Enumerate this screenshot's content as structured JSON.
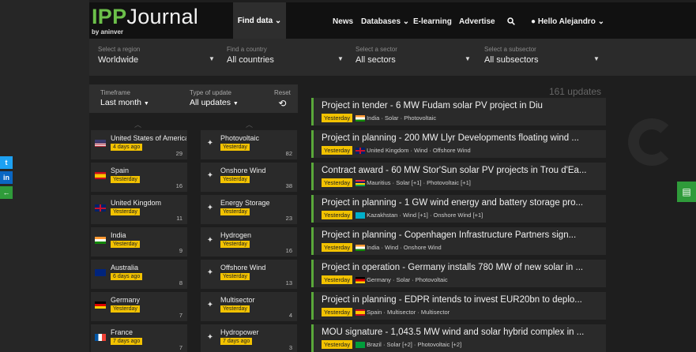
{
  "logo": {
    "brand_ipp": "IPP",
    "brand_rest": "Journal",
    "byline": "by aninver"
  },
  "nav": {
    "find_data": "Find data",
    "items": [
      "News",
      "Databases",
      "E-learning",
      "Advertise"
    ],
    "user": "Hello Alejandro"
  },
  "filters": [
    {
      "label": "Select a region",
      "value": "Worldwide"
    },
    {
      "label": "Find a country",
      "value": "All countries"
    },
    {
      "label": "Select a sector",
      "value": "All sectors"
    },
    {
      "label": "Select a subsector",
      "value": "All subsectors"
    }
  ],
  "timeframe": {
    "label": "Timeframe",
    "value": "Last month"
  },
  "update_type": {
    "label": "Type of update",
    "value": "All updates"
  },
  "reset": {
    "label": "Reset",
    "icon": "reset-icon"
  },
  "update_count": "161 updates",
  "countries": [
    {
      "name": "United States of America",
      "badge": "4 days ago",
      "count": "29",
      "flag": "us"
    },
    {
      "name": "Spain",
      "badge": "Yesterday",
      "count": "16",
      "flag": "es"
    },
    {
      "name": "United Kingdom",
      "badge": "Yesterday",
      "count": "11",
      "flag": "gb"
    },
    {
      "name": "India",
      "badge": "Yesterday",
      "count": "9",
      "flag": "in"
    },
    {
      "name": "Australia",
      "badge": "6 days ago",
      "count": "8",
      "flag": "au"
    },
    {
      "name": "Germany",
      "badge": "Yesterday",
      "count": "7",
      "flag": "de"
    },
    {
      "name": "France",
      "badge": "7 days ago",
      "count": "7",
      "flag": "fr"
    }
  ],
  "sectors": [
    {
      "name": "Photovoltaic",
      "badge": "Yesterday",
      "count": "82",
      "icon": "solar-panel-icon"
    },
    {
      "name": "Onshore Wind",
      "badge": "Yesterday",
      "count": "38",
      "icon": "wind-turbine-icon"
    },
    {
      "name": "Energy Storage",
      "badge": "Yesterday",
      "count": "23",
      "icon": "battery-icon"
    },
    {
      "name": "Hydrogen",
      "badge": "Yesterday",
      "count": "16",
      "icon": "hydrogen-icon"
    },
    {
      "name": "Offshore Wind",
      "badge": "Yesterday",
      "count": "13",
      "icon": "offshore-wind-icon"
    },
    {
      "name": "Multisector",
      "badge": "Yesterday",
      "count": "4",
      "icon": "multisector-icon"
    },
    {
      "name": "Hydropower",
      "badge": "7 days ago",
      "count": "3",
      "icon": "hydropower-icon"
    }
  ],
  "updates": [
    {
      "title": "Project in tender - 6 MW Fudam solar PV project in Diu",
      "badge": "Yesterday",
      "country": "India",
      "flag": "in",
      "tags": "Solar · Photovoltaic"
    },
    {
      "title": "Project in planning - 200 MW Llyr Developments floating wind ...",
      "badge": "Yesterday",
      "country": "United Kingdom",
      "flag": "gb",
      "tags": "Wind · Offshore Wind"
    },
    {
      "title": "Contract award - 60 MW Stor'Sun solar PV projects in Trou d'Ea...",
      "badge": "Yesterday",
      "country": "Mauritius",
      "flag": "mu",
      "tags": "Solar [+1] · Photovoltaic [+1]"
    },
    {
      "title": "Project in planning - 1 GW wind energy and battery storage pro...",
      "badge": "Yesterday",
      "country": "Kazakhstan",
      "flag": "kz",
      "tags": "Wind [+1] · Onshore Wind [+1]"
    },
    {
      "title": "Project in planning - Copenhagen Infrastructure Partners sign...",
      "badge": "Yesterday",
      "country": "India",
      "flag": "in",
      "tags": "Wind · Onshore Wind"
    },
    {
      "title": "Project in operation - Germany installs 780 MW of new solar in ...",
      "badge": "Yesterday",
      "country": "Germany",
      "flag": "de",
      "tags": "Solar · Photovoltaic"
    },
    {
      "title": "Project in planning - EDPR intends to invest EUR20bn to deplo...",
      "badge": "Yesterday",
      "country": "Spain",
      "flag": "es",
      "tags": "Multisector · Multisector"
    },
    {
      "title": "MOU signature - 1,043.5 MW wind and solar hybrid complex in ...",
      "badge": "Yesterday",
      "country": "Brazil",
      "flag": "br",
      "tags": "Solar [+2] · Photovoltaic [+2]"
    }
  ],
  "share": {
    "twitter": "t",
    "linkedin": "in",
    "back": "←"
  },
  "colors": {
    "accent": "#5aa83a",
    "badge": "#f2c200",
    "chat": "#2f9b3a"
  }
}
